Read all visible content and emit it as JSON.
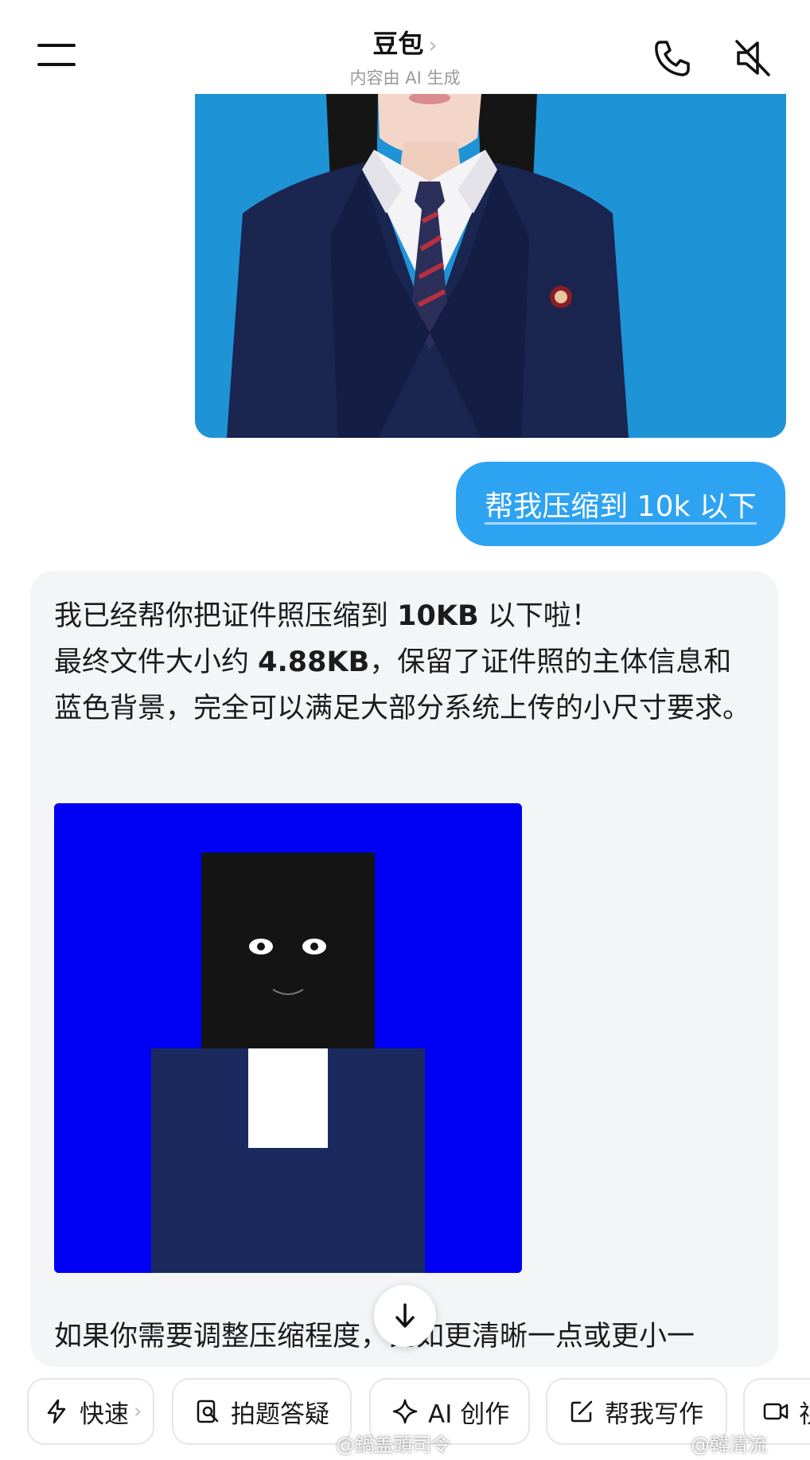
{
  "header": {
    "title": "豆包",
    "subtitle": "内容由 AI 生成"
  },
  "conversation": {
    "user_message": "帮我压缩到 10k 以下",
    "ai_reply": {
      "line1_pre": "我已经帮你把证件照压缩到 ",
      "line1_bold": "10KB",
      "line1_post": " 以下啦！",
      "line2_pre": "最终文件大小约 ",
      "line2_bold": "4.88KB",
      "line2_post": "，保留了证件照的主体信息和蓝色背景，完全可以满足大部分系统上传的小尺寸要求。",
      "partial_text": "如果你需要调整压缩程度，比如更清晰一点或更小一"
    }
  },
  "chips": [
    {
      "label": "快速",
      "icon": "lightning-icon"
    },
    {
      "label": "拍题答疑",
      "icon": "photo-search-icon"
    },
    {
      "label": "AI 创作",
      "icon": "sparkle-icon"
    },
    {
      "label": "帮我写作",
      "icon": "edit-icon"
    },
    {
      "label": "视",
      "icon": "video-icon"
    }
  ],
  "watermarks": [
    "@鍋盖頭司令",
    "@韓清流"
  ],
  "colors": {
    "user_bubble": "#2ea3f2",
    "photo_background": "#1e93d6",
    "compressed_background": "#0000f5",
    "suit": "#1a2550"
  }
}
